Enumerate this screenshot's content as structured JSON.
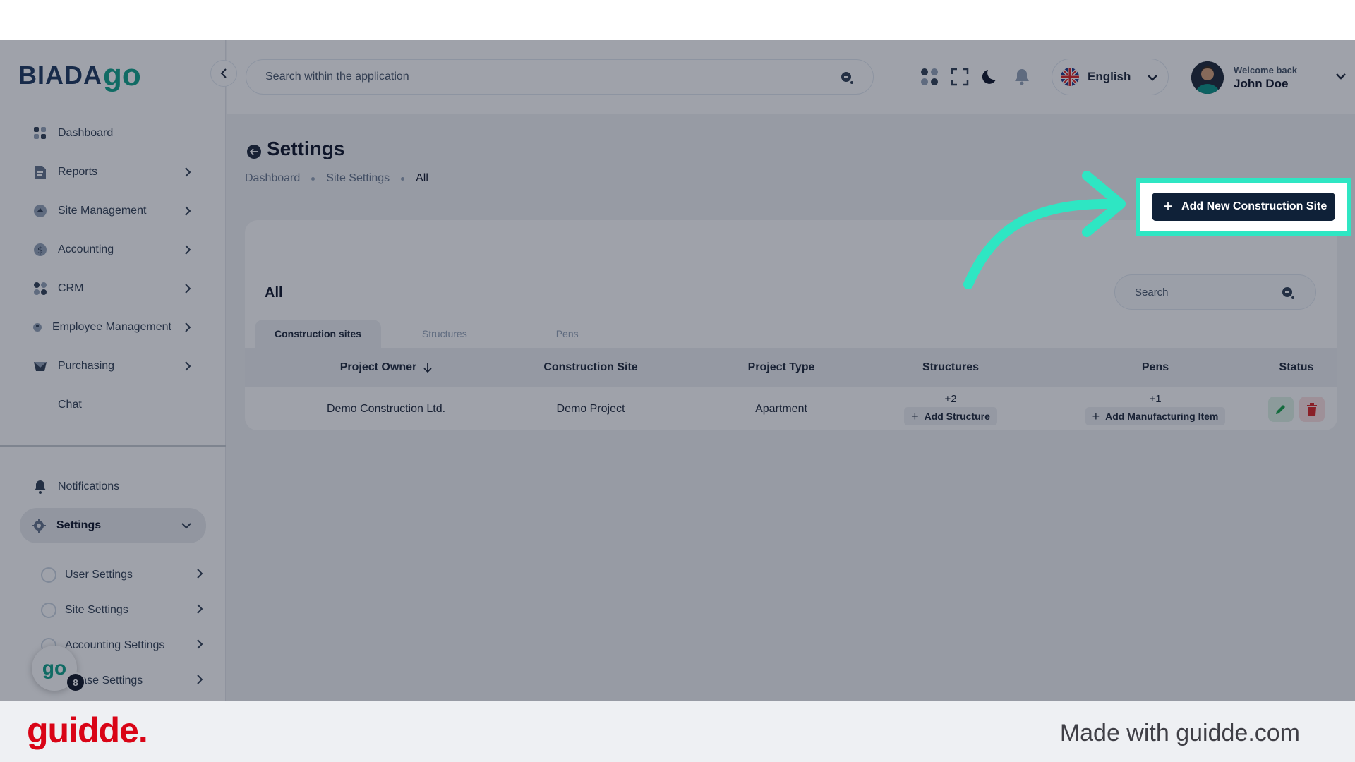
{
  "brand": {
    "logo_main": "BIADA",
    "logo_go": "go"
  },
  "header": {
    "search_placeholder": "Search within the application",
    "language": "English",
    "welcome": "Welcome back",
    "user_name": "John Doe"
  },
  "sidebar": {
    "items": [
      {
        "label": "Dashboard",
        "icon": "dashboard-icon"
      },
      {
        "label": "Reports",
        "icon": "reports-icon"
      },
      {
        "label": "Site Management",
        "icon": "site-management-icon"
      },
      {
        "label": "Accounting",
        "icon": "dollar-icon"
      },
      {
        "label": "CRM",
        "icon": "crm-icon"
      },
      {
        "label": "Employee Management",
        "icon": "employee-icon"
      },
      {
        "label": "Purchasing",
        "icon": "purchasing-icon"
      },
      {
        "label": "Chat",
        "icon": ""
      }
    ],
    "notifications": "Notifications",
    "settings": "Settings",
    "settings_sub": [
      {
        "label": "User Settings"
      },
      {
        "label": "Site Settings"
      },
      {
        "label": "Accounting Settings"
      },
      {
        "label": "rchase Settings"
      }
    ],
    "go_bubble": "go",
    "go_badge": "8"
  },
  "page": {
    "title": "Settings",
    "breadcrumb": [
      "Dashboard",
      "Site Settings",
      "All"
    ],
    "add_button": "Add New Construction Site"
  },
  "card": {
    "title": "All",
    "search_placeholder": "Search",
    "tabs": [
      "Construction sites",
      "Structures",
      "Pens"
    ],
    "columns": [
      "Project Owner",
      "Construction Site",
      "Project Type",
      "Structures",
      "Pens",
      "Status"
    ],
    "rows": [
      {
        "owner": "Demo Construction Ltd.",
        "site": "Demo Project",
        "type": "Apartment",
        "structures_count": "+2",
        "structures_btn": "Add Structure",
        "pens_count": "+1",
        "pens_btn": "Add Manufacturing Item"
      }
    ]
  },
  "footer": {
    "brand": "guidde.",
    "made_with": "Made with guidde.com"
  },
  "colors": {
    "accent": "#2ee6c3",
    "primary": "#0f2138",
    "brand_red": "#d90416",
    "logo_green": "#12a38a"
  }
}
